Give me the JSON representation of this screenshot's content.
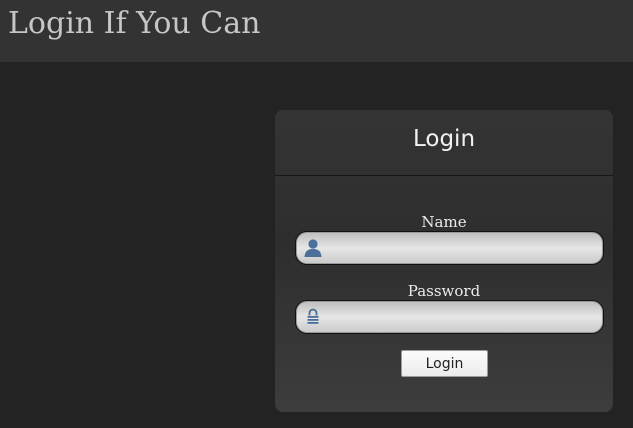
{
  "header": {
    "site_title": "Login If You Can"
  },
  "login_panel": {
    "title": "Login",
    "name_field": {
      "label": "Name",
      "value": "",
      "placeholder": "",
      "icon": "user-icon"
    },
    "password_field": {
      "label": "Password",
      "value": "",
      "placeholder": "",
      "icon": "lock-icon"
    },
    "submit_label": "Login"
  },
  "colors": {
    "page_background": "#232323",
    "header_background": "#333333",
    "site_title_text": "#c6c6c6",
    "panel_title_text": "#f2f2f2",
    "icon_blue": "#4a6f9b"
  }
}
